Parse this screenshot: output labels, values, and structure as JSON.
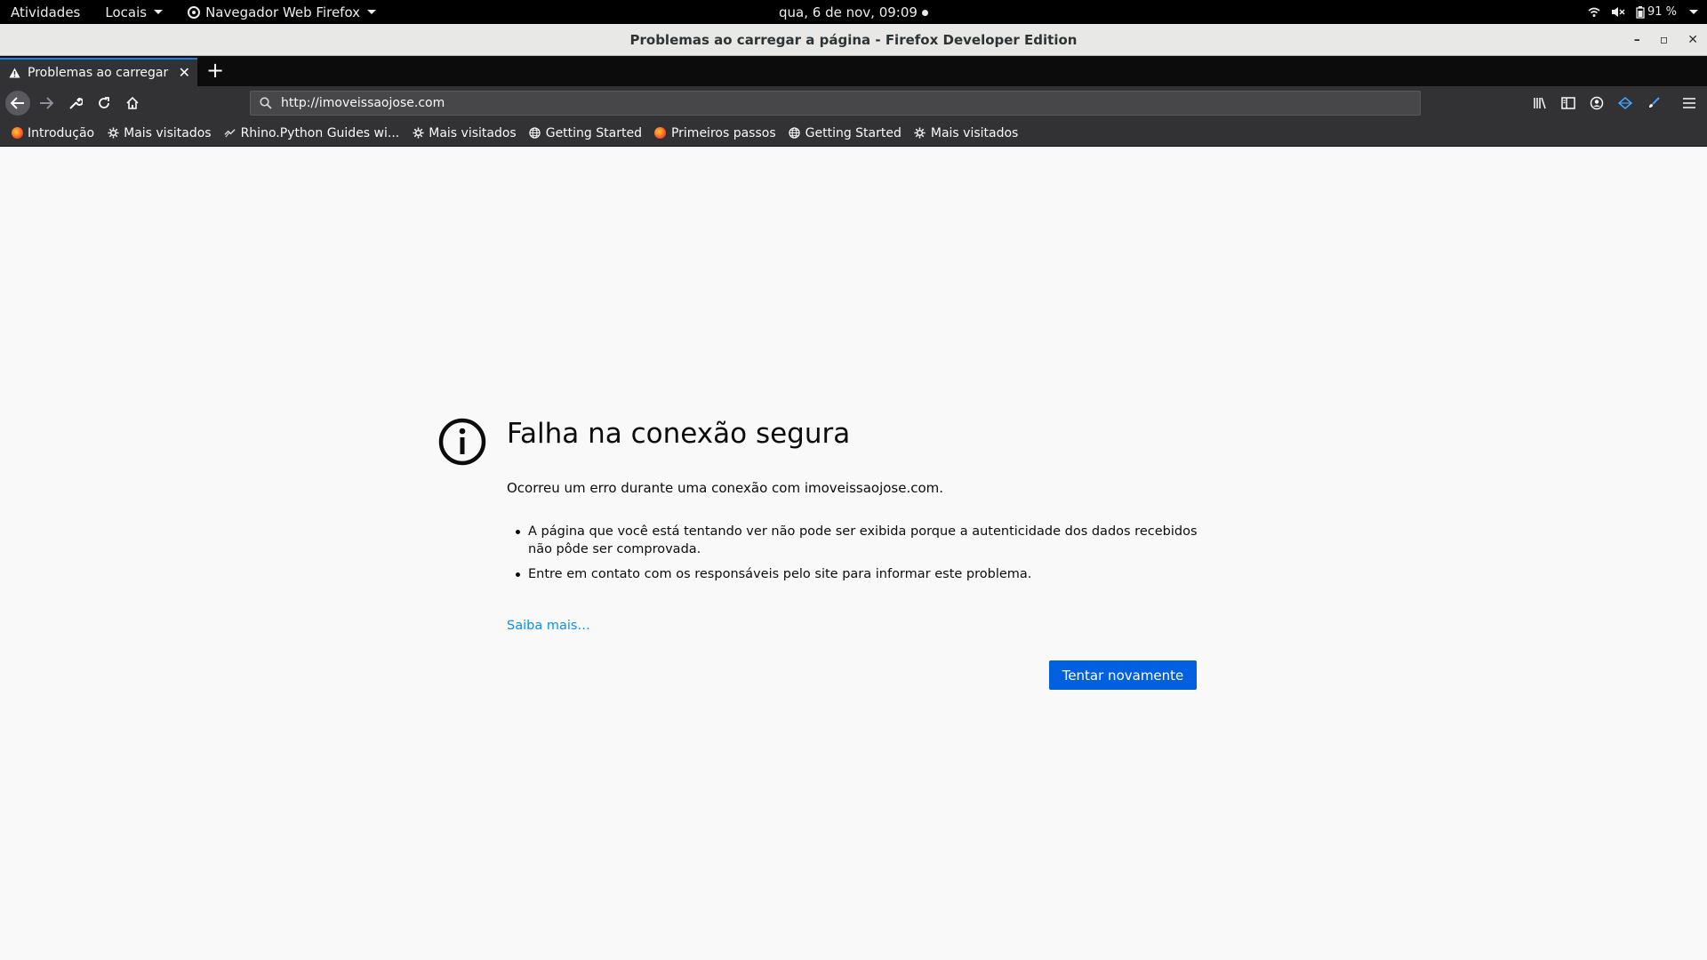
{
  "gnome": {
    "activities": "Atividades",
    "places": "Locais",
    "app_name": "Navegador Web Firefox",
    "clock": "qua,  6 de nov, 09:09",
    "battery": "91 %"
  },
  "window": {
    "title": "Problemas ao carregar a página - Firefox Developer Edition",
    "minimize": "–",
    "maximize": "▫",
    "close": "✕"
  },
  "tab": {
    "title": "Problemas ao carregar a p",
    "close": "✕",
    "new_tab": "+"
  },
  "navbar": {
    "url": "http://imoveissaojose.com"
  },
  "bookmarks": [
    {
      "label": "Introdução",
      "icon": "firefox-icon"
    },
    {
      "label": "Mais visitados",
      "icon": "gear-icon"
    },
    {
      "label": "Rhino.Python Guides wi...",
      "icon": "rhino-icon"
    },
    {
      "label": "Mais visitados",
      "icon": "gear-icon"
    },
    {
      "label": "Getting Started",
      "icon": "globe-icon"
    },
    {
      "label": "Primeiros passos",
      "icon": "firefox-icon"
    },
    {
      "label": "Getting Started",
      "icon": "globe-icon"
    },
    {
      "label": "Mais visitados",
      "icon": "gear-icon"
    }
  ],
  "error": {
    "title": "Falha na conexão segura",
    "message": "Ocorreu um erro durante uma conexão com imoveissaojose.com.",
    "bullets": [
      "A página que você está tentando ver não pode ser exibida porque a autenticidade dos dados recebidos não pôde ser comprovada.",
      "Entre em contato com os responsáveis pelo site para informar este problema."
    ],
    "learn_more": "Saiba mais…",
    "retry_button": "Tentar novamente"
  },
  "colors": {
    "accent": "#0a84ff",
    "button": "#0060df",
    "link": "#0a8dff"
  }
}
